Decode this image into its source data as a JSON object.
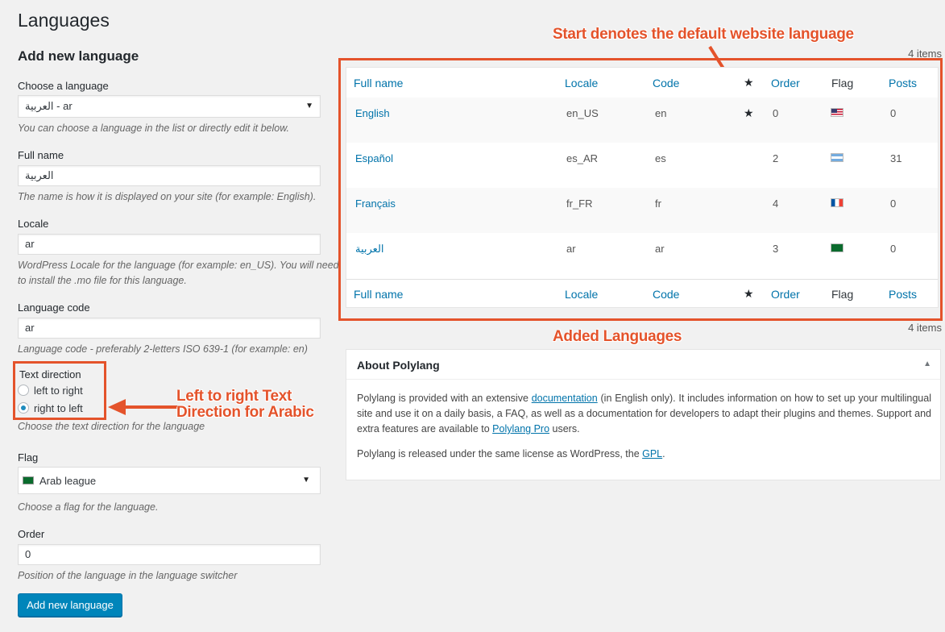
{
  "page_title": "Languages",
  "form": {
    "heading": "Add new language",
    "choose_label": "Choose a language",
    "choose_value": "العربية - ar",
    "choose_desc": "You can choose a language in the list or directly edit it below.",
    "fullname_label": "Full name",
    "fullname_value": "العربية",
    "fullname_desc": "The name is how it is displayed on your site (for example: English).",
    "locale_label": "Locale",
    "locale_value": "ar",
    "locale_desc_1": "WordPress Locale for the language (for example: en_US). You will need",
    "locale_desc_2": "to install the .mo file for this language.",
    "code_label": "Language code",
    "code_value": "ar",
    "code_desc": "Language code - preferably 2-letters ISO 639-1 (for example: en)",
    "direction_label": "Text direction",
    "direction_ltr": "left to right",
    "direction_rtl": "right to left",
    "direction_desc": "Choose the text direction for the language",
    "flag_label": "Flag",
    "flag_value": "Arab league",
    "flag_desc": "Choose a flag for the language.",
    "order_label": "Order",
    "order_value": "0",
    "order_desc": "Position of the language in the language switcher",
    "submit_label": "Add new language"
  },
  "table": {
    "count_top": "4 items",
    "count_bottom": "4 items",
    "columns": {
      "fullname": "Full name",
      "locale": "Locale",
      "code": "Code",
      "order": "Order",
      "flag": "Flag",
      "posts": "Posts"
    },
    "rows": [
      {
        "name": "English",
        "locale": "en_US",
        "code": "en",
        "default": true,
        "order": "0",
        "posts": "0",
        "flag": "us"
      },
      {
        "name": "Español",
        "locale": "es_AR",
        "code": "es",
        "default": false,
        "order": "2",
        "posts": "31",
        "flag": "ar"
      },
      {
        "name": "Français",
        "locale": "fr_FR",
        "code": "fr",
        "default": false,
        "order": "4",
        "posts": "0",
        "flag": "fr"
      },
      {
        "name": "العربية",
        "locale": "ar",
        "code": "ar",
        "default": false,
        "order": "3",
        "posts": "0",
        "flag": "arab-league"
      }
    ]
  },
  "about": {
    "title": "About Polylang",
    "p1_a": "Polylang is provided with an extensive ",
    "p1_link1": "documentation",
    "p1_b": " (in English only). It includes information on how to set up your multilingual site and use it on a daily basis, a FAQ, as well as a documentation for developers to adapt their plugins and themes. Support and extra features are available to ",
    "p1_link2": "Polylang Pro",
    "p1_c": " users.",
    "p2_a": "Polylang is released under the same license as WordPress, the ",
    "p2_link": "GPL",
    "p2_b": "."
  },
  "annotations": {
    "star": "Start denotes the default website language",
    "added": "Added Languages",
    "direction_1": "Left to right Text",
    "direction_2": "Direction for Arabic"
  },
  "colors": {
    "accent": "#0073aa",
    "button": "#0085ba",
    "annotation": "#e4532b"
  }
}
